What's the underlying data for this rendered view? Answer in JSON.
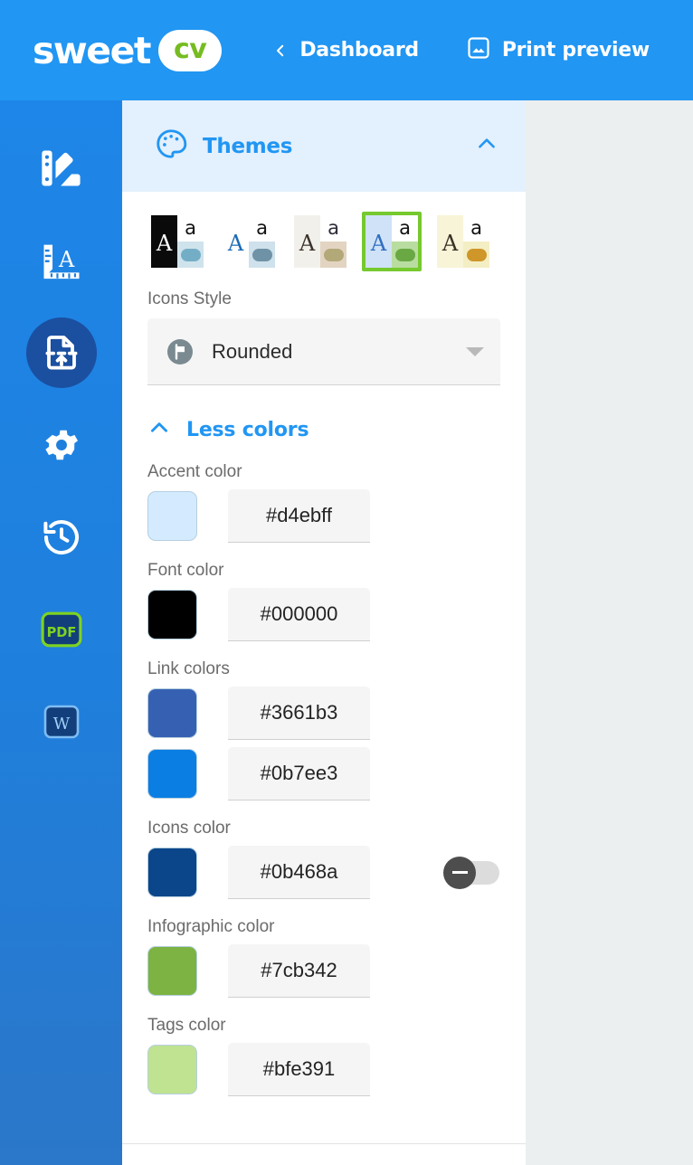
{
  "header": {
    "logo_word": "sweet",
    "logo_badge": "cv",
    "back_icon": "chevron-left-icon",
    "dashboard_label": "Dashboard",
    "print_icon": "image-icon",
    "print_label": "Print preview",
    "bar_color": "#2196f3",
    "badge_text_color": "#76bc21"
  },
  "sidebar": {
    "background_color": "#1f7fdc",
    "items": [
      {
        "name": "sidebar-item-themes",
        "icon": "color-palette-swatches-icon",
        "active": false
      },
      {
        "name": "sidebar-item-typography",
        "icon": "ruler-letter-icon",
        "active": false
      },
      {
        "name": "sidebar-item-import",
        "icon": "document-upload-icon",
        "active": true
      },
      {
        "name": "sidebar-item-settings",
        "icon": "gear-icon",
        "active": false
      },
      {
        "name": "sidebar-item-history",
        "icon": "history-clock-icon",
        "active": false
      },
      {
        "name": "sidebar-item-export-pdf",
        "icon": "pdf-icon",
        "label": "PDF",
        "active": false
      },
      {
        "name": "sidebar-item-export-word",
        "icon": "word-icon",
        "label": "W",
        "active": false
      }
    ]
  },
  "panel": {
    "section_title": "Themes",
    "section_icon": "palette-icon",
    "collapse_icon": "chevron-up-icon",
    "header_bg": "#e3f0fd",
    "accent": "#2196f3",
    "themes": [
      {
        "name": "theme-dark",
        "bg_A": "#0a0a0a",
        "color_A": "#ffffff",
        "bg_a": "#ffffff",
        "color_a": "#111111",
        "bg_pill": "#cfe3ec",
        "pill": "#74aec6",
        "selected": false
      },
      {
        "name": "theme-white-blue",
        "bg_A": "#ffffff",
        "color_A": "#1a6bb5",
        "bg_a": "#ffffff",
        "color_a": "#111111",
        "bg_pill": "#cfe1ec",
        "pill": "#6f92a6",
        "selected": false
      },
      {
        "name": "theme-beige",
        "bg_A": "#f2f0eb",
        "color_A": "#3c342c",
        "bg_a": "#ffffff",
        "color_a": "#2b2b38",
        "bg_pill": "#e3d4c2",
        "pill": "#b3a878",
        "selected": false
      },
      {
        "name": "theme-blue-green",
        "bg_A": "#cfe2f7",
        "color_A": "#2f6fc0",
        "bg_a": "#ffffff",
        "color_a": "#111111",
        "bg_pill": "#b9dda0",
        "pill": "#6aa844",
        "selected": true
      },
      {
        "name": "theme-cream",
        "bg_A": "#f8f4d8",
        "color_A": "#3a3226",
        "bg_a": "#ffffff",
        "color_a": "#111111",
        "bg_pill": "#f4eec4",
        "pill": "#cf962a",
        "selected": false
      }
    ],
    "selected_ring_color": "#76c92e",
    "icons_style": {
      "label": "Icons Style",
      "value": "Rounded",
      "icon": "flag-circle-icon",
      "caret_icon": "chevron-down-icon"
    },
    "less_colors": {
      "label": "Less colors",
      "icon": "chevron-up-icon"
    },
    "colors": [
      {
        "name": "accent-color",
        "label": "Accent color",
        "value": "#d4ebff",
        "swatch": "#d4ebff",
        "toggle": null
      },
      {
        "name": "font-color",
        "label": "Font color",
        "value": "#000000",
        "swatch": "#000000",
        "toggle": null
      },
      {
        "name": "link-color-1",
        "label": "Link colors",
        "value": "#3661b3",
        "swatch": "#3661b3",
        "toggle": null
      },
      {
        "name": "link-color-2",
        "label": "",
        "value": "#0b7ee3",
        "swatch": "#0b7ee3",
        "toggle": null
      },
      {
        "name": "icons-color",
        "label": "Icons color",
        "value": "#0b468a",
        "swatch": "#0b468a",
        "toggle": "off"
      },
      {
        "name": "infographic-color",
        "label": "Infographic color",
        "value": "#7cb342",
        "swatch": "#7cb342",
        "toggle": null
      },
      {
        "name": "tags-color",
        "label": "Tags color",
        "value": "#bfe391",
        "swatch": "#bfe391",
        "toggle": null
      }
    ]
  }
}
